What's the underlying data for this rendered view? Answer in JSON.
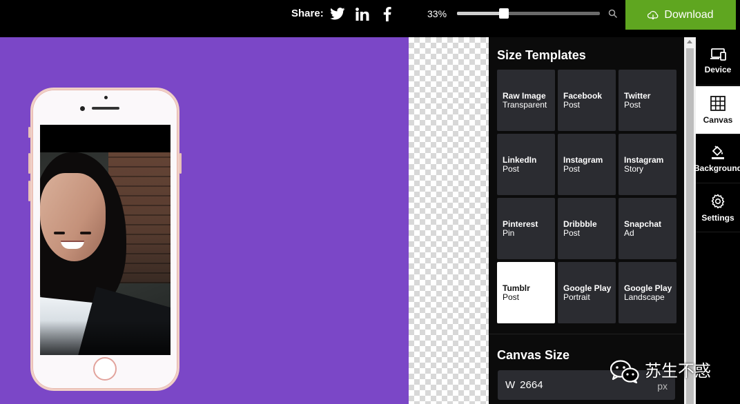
{
  "topbar": {
    "share_label": "Share:",
    "share_icons": [
      "twitter-icon",
      "linkedin-icon",
      "facebook-icon"
    ],
    "zoom": {
      "label": "33%",
      "value": 0.33
    },
    "download_label": "Download"
  },
  "size_templates": {
    "title": "Size Templates",
    "items": [
      {
        "name": "Raw Image",
        "sub": "Transparent",
        "active": false
      },
      {
        "name": "Facebook",
        "sub": "Post",
        "active": false
      },
      {
        "name": "Twitter",
        "sub": "Post",
        "active": false
      },
      {
        "name": "LinkedIn",
        "sub": "Post",
        "active": false
      },
      {
        "name": "Instagram",
        "sub": "Post",
        "active": false
      },
      {
        "name": "Instagram",
        "sub": "Story",
        "active": false
      },
      {
        "name": "Pinterest",
        "sub": "Pin",
        "active": false
      },
      {
        "name": "Dribbble",
        "sub": "Post",
        "active": false
      },
      {
        "name": "Snapchat",
        "sub": "Ad",
        "active": false
      },
      {
        "name": "Tumblr",
        "sub": "Post",
        "active": true
      },
      {
        "name": "Google Play",
        "sub": "Portrait",
        "active": false
      },
      {
        "name": "Google Play",
        "sub": "Landscape",
        "active": false
      }
    ]
  },
  "canvas_size": {
    "title": "Canvas Size",
    "width_prefix": "W",
    "width_value": "2664",
    "unit": "px"
  },
  "sidenav": [
    {
      "label": "Device",
      "icon": "device-icon",
      "active": false
    },
    {
      "label": "Canvas",
      "icon": "grid-icon",
      "active": true
    },
    {
      "label": "Background",
      "icon": "paint-bucket-icon",
      "active": false
    },
    {
      "label": "Settings",
      "icon": "gear-icon",
      "active": false
    }
  ],
  "watermark": {
    "text": "苏生不惑"
  },
  "colors": {
    "canvas_background": "#7b47c7",
    "download_button": "#5fa620",
    "tile_background": "#2b2c31",
    "tile_active": "#ffffff"
  }
}
